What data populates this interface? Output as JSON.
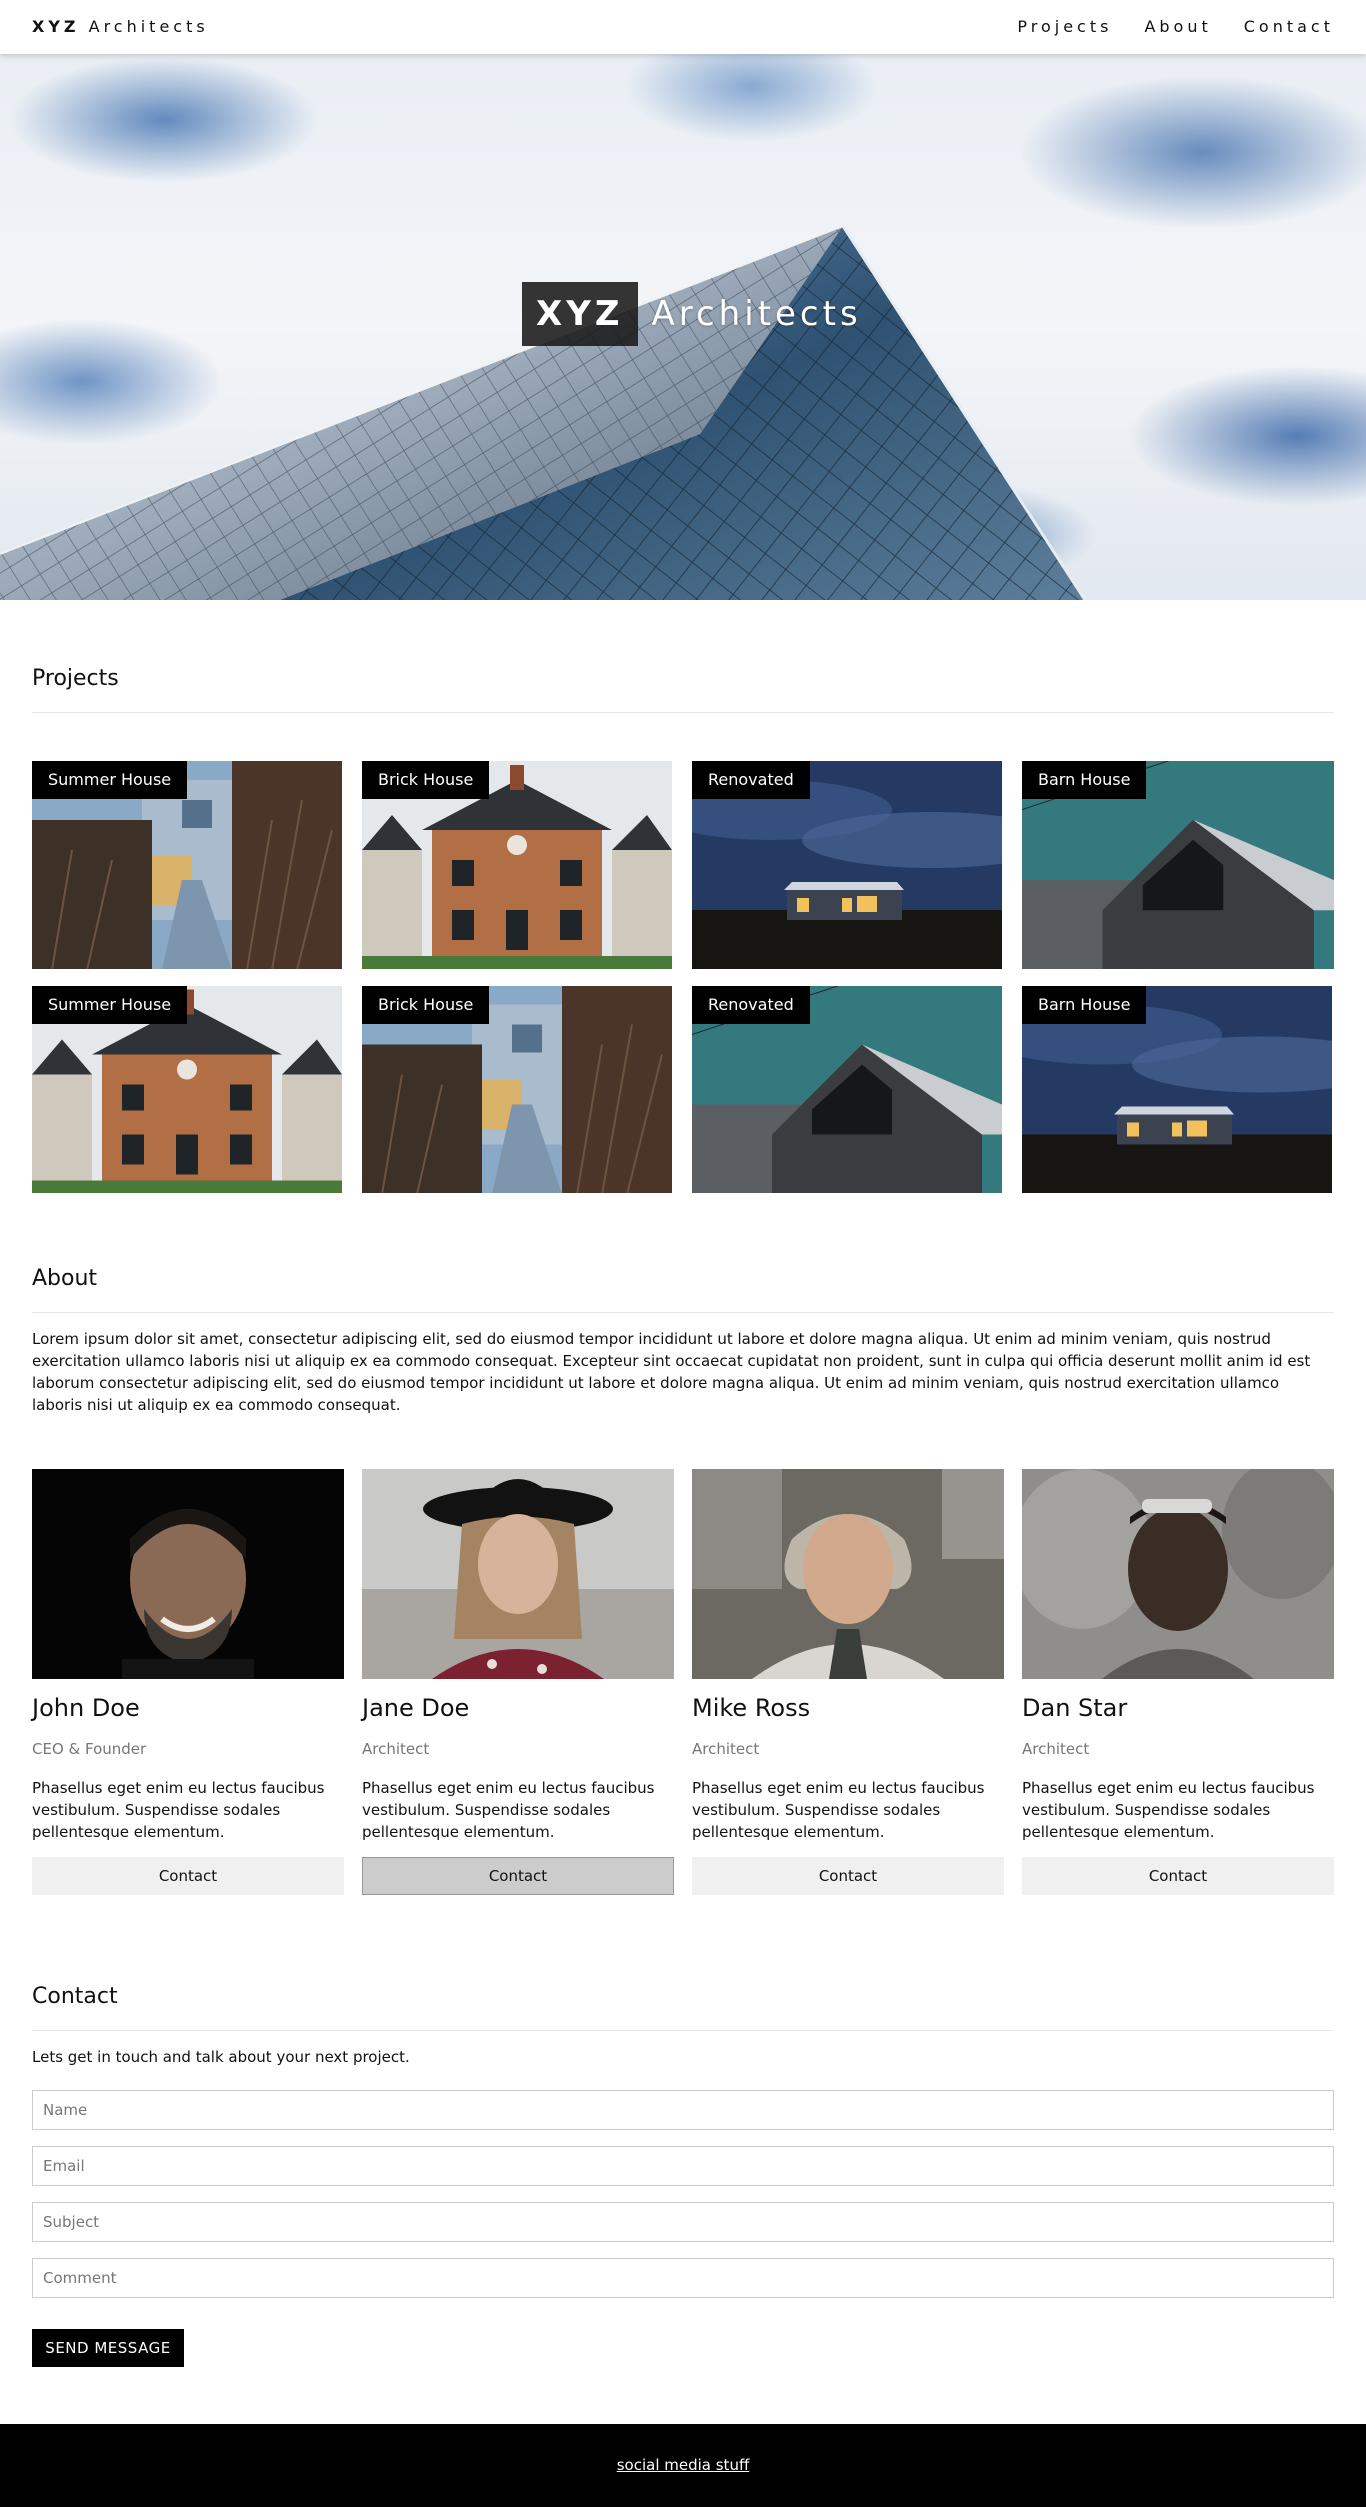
{
  "header": {
    "brand_bold": "XYZ",
    "brand_rest": "Architects",
    "nav": [
      "Projects",
      "About",
      "Contact"
    ]
  },
  "hero": {
    "title_bold": "XYZ",
    "title_rest": "Architects"
  },
  "projects": {
    "heading": "Projects",
    "items": [
      {
        "label": "Summer House",
        "scene": "boardwalk"
      },
      {
        "label": "Brick House",
        "scene": "brick"
      },
      {
        "label": "Renovated",
        "scene": "dusk"
      },
      {
        "label": "Barn House",
        "scene": "barn"
      },
      {
        "label": "Summer House",
        "scene": "brick"
      },
      {
        "label": "Brick House",
        "scene": "boardwalk"
      },
      {
        "label": "Renovated",
        "scene": "barn"
      },
      {
        "label": "Barn House",
        "scene": "dusk"
      }
    ]
  },
  "about": {
    "heading": "About",
    "text": "Lorem ipsum dolor sit amet, consectetur adipiscing elit, sed do eiusmod tempor incididunt ut labore et dolore magna aliqua. Ut enim ad minim veniam, quis nostrud exercitation ullamco laboris nisi ut aliquip ex ea commodo consequat. Excepteur sint occaecat cupidatat non proident, sunt in culpa qui officia deserunt mollit anim id est laborum consectetur adipiscing elit, sed do eiusmod tempor incididunt ut labore et dolore magna aliqua. Ut enim ad minim veniam, quis nostrud exercitation ullamco laboris nisi ut aliquip ex ea commodo consequat."
  },
  "team": [
    {
      "name": "John Doe",
      "role": "CEO & Founder",
      "desc": "Phasellus eget enim eu lectus faucibus vestibulum. Suspendisse sodales pellentesque elementum.",
      "button": "Contact"
    },
    {
      "name": "Jane Doe",
      "role": "Architect",
      "desc": "Phasellus eget enim eu lectus faucibus vestibulum. Suspendisse sodales pellentesque elementum.",
      "button": "Contact"
    },
    {
      "name": "Mike Ross",
      "role": "Architect",
      "desc": "Phasellus eget enim eu lectus faucibus vestibulum. Suspendisse sodales pellentesque elementum.",
      "button": "Contact"
    },
    {
      "name": "Dan Star",
      "role": "Architect",
      "desc": "Phasellus eget enim eu lectus faucibus vestibulum. Suspendisse sodales pellentesque elementum.",
      "button": "Contact"
    }
  ],
  "contact": {
    "heading": "Contact",
    "intro": "Lets get in touch and talk about your next project.",
    "fields": {
      "name": {
        "placeholder": "Name",
        "value": ""
      },
      "email": {
        "placeholder": "Email",
        "value": ""
      },
      "subject": {
        "placeholder": "Subject",
        "value": ""
      },
      "comment": {
        "placeholder": "Comment",
        "value": ""
      }
    },
    "send_label": "SEND MESSAGE"
  },
  "footer": {
    "link": "social media stuff"
  },
  "colors": {
    "accent": "#000000",
    "button_bg": "#f0f0f0",
    "button_active_bg": "#cccccc",
    "muted_text": "#777777",
    "divider": "#e7e7e7"
  }
}
